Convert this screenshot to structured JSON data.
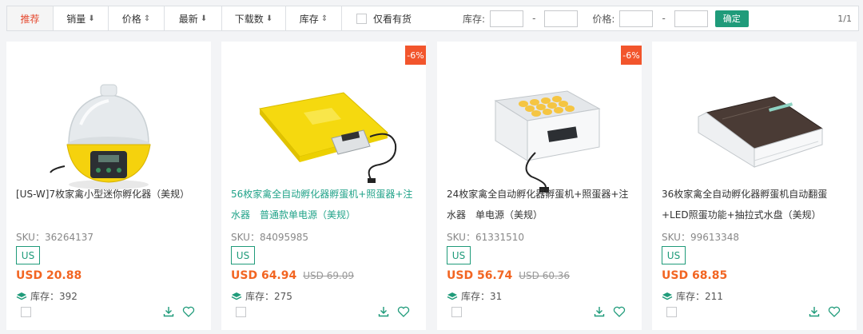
{
  "toolbar": {
    "sorts": [
      {
        "label": "推荐",
        "arrow": ""
      },
      {
        "label": "销量",
        "arrow": "⬇"
      },
      {
        "label": "价格",
        "arrow": "⇕"
      },
      {
        "label": "最新",
        "arrow": "⬇"
      },
      {
        "label": "下载数",
        "arrow": "⬇"
      },
      {
        "label": "库存",
        "arrow": "⇕"
      }
    ],
    "stock_only_label": "仅看有货",
    "stock_range_label": "库存:",
    "price_range_label": "价格:",
    "dash": "-",
    "confirm_label": "确定",
    "page_info": "1/1"
  },
  "products": [
    {
      "title": "[US-W]7枚家禽小型迷你孵化器（美规）",
      "sku": "SKU：36264137",
      "badge": "US",
      "price": "USD 20.88",
      "old_price": "",
      "discount": "",
      "stock": "库存：392"
    },
    {
      "title": "56枚家禽全自动孵化器孵蛋机+照蛋器+注水器　普通款单电源（美规）",
      "sku": "SKU：84095985",
      "badge": "US",
      "price": "USD 64.94",
      "old_price": "USD 69.09",
      "discount": "-6%",
      "stock": "库存：275"
    },
    {
      "title": "24枚家禽全自动孵化器孵蛋机+照蛋器+注水器　单电源（美规）",
      "sku": "SKU：61331510",
      "badge": "US",
      "price": "USD 56.74",
      "old_price": "USD 60.36",
      "discount": "-6%",
      "stock": "库存：31"
    },
    {
      "title": "36枚家禽全自动孵化器孵蛋机自动翻蛋+LED照蛋功能+抽拉式水盘（美规）",
      "sku": "SKU：99613348",
      "badge": "US",
      "price": "USD 68.85",
      "old_price": "",
      "discount": "",
      "stock": "库存：211"
    }
  ]
}
